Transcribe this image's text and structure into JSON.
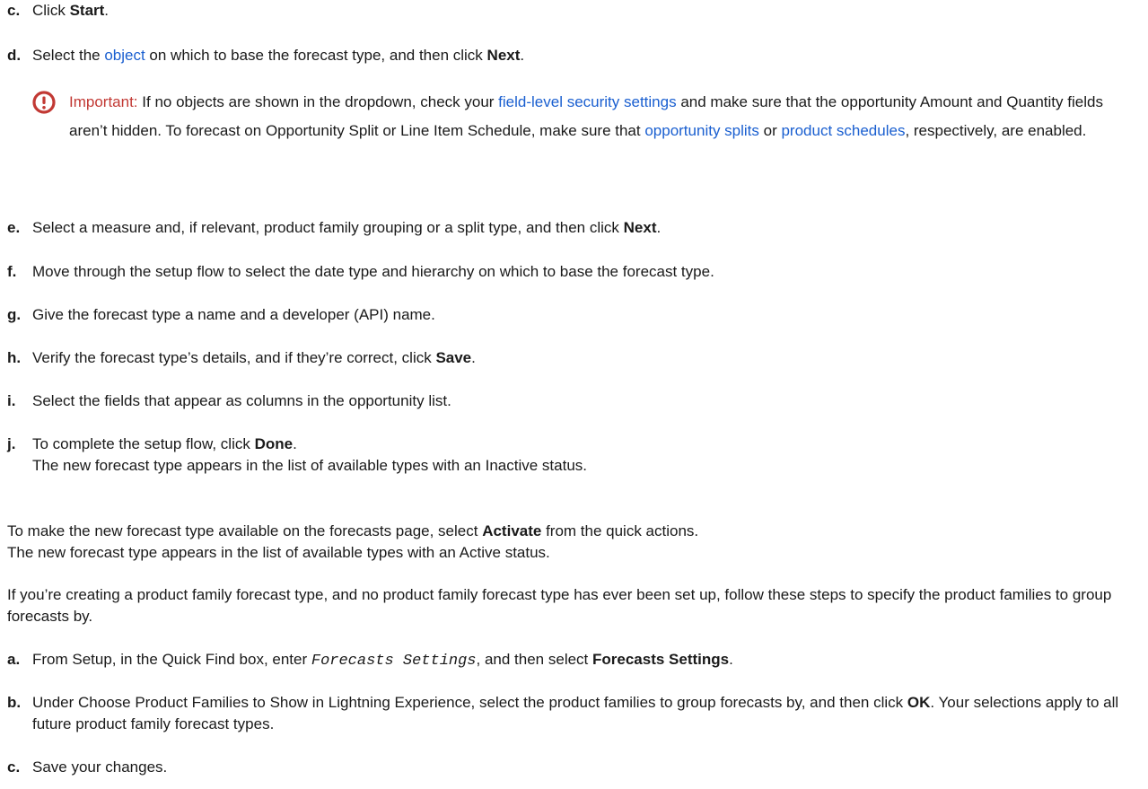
{
  "steps_top": {
    "c": {
      "letter": "c.",
      "pre": "Click ",
      "bold": "Start",
      "post": "."
    },
    "d": {
      "letter": "d.",
      "pre": "Select the ",
      "link": "object",
      "mid": " on which to base the forecast type, and then click ",
      "bold": "Next",
      "post": "."
    },
    "e": {
      "letter": "e.",
      "pre": "Select a measure and, if relevant, product family grouping or a split type, and then click ",
      "bold": "Next",
      "post": "."
    },
    "f": {
      "letter": "f.",
      "text": "Move through the setup flow to select the date type and hierarchy on which to base the forecast type."
    },
    "g": {
      "letter": "g.",
      "text": "Give the forecast type a name and a developer (API) name."
    },
    "h": {
      "letter": "h.",
      "pre": "Verify the forecast type’s details, and if they’re correct, click ",
      "bold": "Save",
      "post": "."
    },
    "i": {
      "letter": "i.",
      "text": "Select the fields that appear as columns in the opportunity list."
    },
    "j": {
      "letter": "j.",
      "pre": "To complete the setup flow, click ",
      "bold": "Done",
      "post": ".",
      "line2": "The new forecast type appears in the list of available types with an Inactive status."
    }
  },
  "note": {
    "icon": "alert-circle-icon",
    "color": "#c23934",
    "label": "Important:",
    "t1": "  If no objects are shown in the dropdown, check your ",
    "link1": "field-level security settings",
    "t2": " and make sure that the opportunity Amount and Quantity fields aren’t hidden. To forecast on Opportunity Split or Line Item Schedule, make sure that ",
    "link2": "opportunity splits",
    "t3": " or ",
    "link3": "product schedules",
    "t4": ", respectively, are enabled."
  },
  "activate": {
    "pre": "To make the new forecast type available on the forecasts page, select ",
    "bold": "Activate",
    "post": " from the quick actions.",
    "line2": "The new forecast type appears in the list of available types with an Active status."
  },
  "product_family": {
    "text": "If you’re creating a product family forecast type, and no product family forecast type has ever been set up, follow these steps to specify the product families to group forecasts by."
  },
  "steps_bottom": {
    "a": {
      "letter": "a.",
      "pre": "From Setup, in the Quick Find box, enter ",
      "code": "Forecasts Settings",
      "mid": ", and then select ",
      "bold": "Forecasts Settings",
      "post": "."
    },
    "b": {
      "letter": "b.",
      "pre": "Under Choose Product Families to Show in Lightning Experience, select the product families to group forecasts by, and then click ",
      "bold": "OK",
      "post": ". Your selections apply to all future product family forecast types."
    },
    "c": {
      "letter": "c.",
      "text": "Save your changes."
    }
  }
}
